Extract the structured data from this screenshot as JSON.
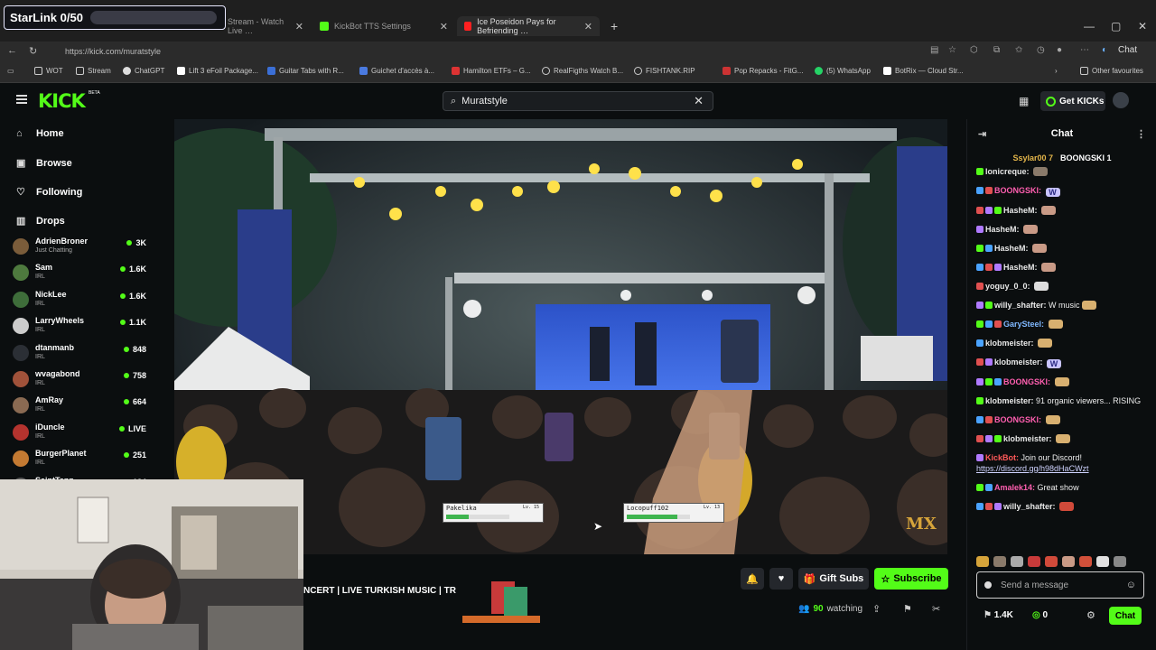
{
  "overlay": {
    "starlink": "StarLink 0/50"
  },
  "browser": {
    "tabs": [
      {
        "title": "Stream - Watch Live …"
      },
      {
        "title": "KickBot TTS Settings"
      },
      {
        "title": "Ice Poseidon Pays for Befriending …"
      }
    ],
    "new_tab": "+",
    "url": "https://kick.com/muratstyle",
    "chat_btn": "Chat",
    "bookmarks": [
      "WOT",
      "Stream",
      "ChatGPT",
      "Lift 3 eFoil Package...",
      "Guitar Tabs with R...",
      "Guichet d'accès à...",
      "Hamilton ETFs – G...",
      "RealFigths Watch B...",
      "FISHTANK.RIP",
      "Pop Repacks - FitG...",
      "(5) WhatsApp",
      "BotRix — Cloud Str...",
      "Other favourites"
    ]
  },
  "kick": {
    "logo": "KICK",
    "beta": "BETA",
    "search_value": "Muratstyle",
    "get_kicks": "Get KICKs"
  },
  "sidebar": {
    "nav": [
      {
        "label": "Home",
        "icon": "home-icon"
      },
      {
        "label": "Browse",
        "icon": "browse-icon"
      },
      {
        "label": "Following",
        "icon": "heart-icon"
      },
      {
        "label": "Drops",
        "icon": "drops-icon"
      }
    ],
    "channels": [
      {
        "name": "AdrienBroner",
        "cat": "Just Chatting",
        "count": "3K",
        "color": "#7a5c3a"
      },
      {
        "name": "Sam",
        "cat": "IRL",
        "count": "1.6K",
        "color": "#4e7a3e"
      },
      {
        "name": "NickLee",
        "cat": "IRL",
        "count": "1.6K",
        "color": "#3e6d3a"
      },
      {
        "name": "LarryWheels",
        "cat": "IRL",
        "count": "1.1K",
        "color": "#cccccc"
      },
      {
        "name": "dtanmanb",
        "cat": "IRL",
        "count": "848",
        "color": "#2b2f35"
      },
      {
        "name": "wvagabond",
        "cat": "IRL",
        "count": "758",
        "color": "#a0523a"
      },
      {
        "name": "AmRay",
        "cat": "IRL",
        "count": "664",
        "color": "#8a6a52"
      },
      {
        "name": "iDuncle",
        "cat": "IRL",
        "count": "LIVE",
        "color": "#b4332e"
      },
      {
        "name": "BurgerPlanet",
        "cat": "IRL",
        "count": "251",
        "color": "#c47a32"
      },
      {
        "name": "SaintTenn",
        "cat": "",
        "count": "134",
        "color": "#555555"
      }
    ]
  },
  "video": {
    "hp1": {
      "name": "Pakelika",
      "lv": "Lv. 15",
      "hp": 0.35
    },
    "hp2": {
      "name": "Locopuff102",
      "lv": "Lv. 13",
      "hp": 0.8
    },
    "watermark": "MX"
  },
  "stream": {
    "title": "NCERT | LIVE TURKISH MUSIC | TR",
    "gift_subs": "Gift Subs",
    "subscribe": "Subscribe",
    "watching_count": "90",
    "watching_label": "watching"
  },
  "chat": {
    "header": "Chat",
    "pinned": [
      {
        "name": "Ssylar00",
        "count": "7"
      },
      {
        "name": "BOONGSKI",
        "count": "1"
      }
    ],
    "messages": [
      {
        "user": "lonicreque:",
        "color": "#e8e8e8",
        "text": "",
        "emote": "#8a7a6a"
      },
      {
        "user": "BOONGSKI:",
        "color": "#ff5fb0",
        "text": "",
        "emote": "#c9c4ff",
        "etext": "W"
      },
      {
        "user": "HasheM:",
        "color": "#e8e8e8",
        "text": "",
        "emote": "#c99a86"
      },
      {
        "user": "HasheM:",
        "color": "#e8e8e8",
        "text": "",
        "emote": "#c99a86"
      },
      {
        "user": "HasheM:",
        "color": "#e8e8e8",
        "text": "",
        "emote": "#c99a86"
      },
      {
        "user": "HasheM:",
        "color": "#e8e8e8",
        "text": "",
        "emote": "#c99a86"
      },
      {
        "user": "yoguy_0_0:",
        "color": "#e8e8e8",
        "text": "",
        "emote": "#dddddd"
      },
      {
        "user": "willy_shafter:",
        "color": "#e8e8e8",
        "text": "W music",
        "emote": "#d8b070"
      },
      {
        "user": "GarySteel:",
        "color": "#7fb8ff",
        "text": "",
        "emote": "#d8b070"
      },
      {
        "user": "klobmeister:",
        "color": "#e8e8e8",
        "text": "",
        "emote": "#d8b070"
      },
      {
        "user": "klobmeister:",
        "color": "#e8e8e8",
        "text": "",
        "emote": "#c9c4ff",
        "etext": "W"
      },
      {
        "user": "BOONGSKI:",
        "color": "#ff5fb0",
        "text": "",
        "emote": "#d8b070"
      },
      {
        "user": "klobmeister:",
        "color": "#e8e8e8",
        "text": "91 organic viewers... RISING",
        "emote": ""
      },
      {
        "user": "BOONGSKI:",
        "color": "#ff5fb0",
        "text": "",
        "emote": "#d8b070"
      },
      {
        "user": "klobmeister:",
        "color": "#e8e8e8",
        "text": "",
        "emote": "#d8b070"
      },
      {
        "user": "KickBot:",
        "color": "#ff5a5a",
        "text": "Join our Discord!",
        "link": "https://discord.gg/h98dHaCWzt",
        "emote": ""
      },
      {
        "user": "Amalek14:",
        "color": "#ff5fb0",
        "text": "Great show",
        "emote": ""
      },
      {
        "user": "willy_shafter:",
        "color": "#e8e8e8",
        "text": "",
        "emote": "#d14a3a"
      }
    ],
    "input_placeholder": "Send a message",
    "kicks": "1.4K",
    "points": "0",
    "send": "Chat"
  }
}
